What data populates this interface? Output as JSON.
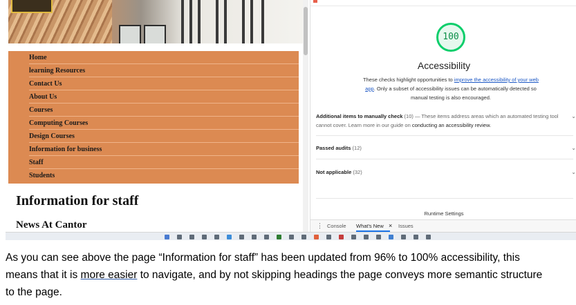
{
  "website": {
    "nav_items": [
      "Home",
      "learning Resources",
      "Contact Us",
      "About Us",
      "Courses",
      "Computing Courses",
      "Design Courses",
      "Information for business",
      "Staff",
      "Students"
    ],
    "page_title": "Information for staff",
    "section_heading": "News At Cantor"
  },
  "devtools": {
    "score": "100",
    "category_title": "Accessibility",
    "description_before": "These checks highlight opportunities to ",
    "description_link": "improve the accessibility of your web app",
    "description_after": ". Only a subset of accessibility issues can be automatically detected so manual testing is also encouraged.",
    "manual_label": "Additional items to manually check",
    "manual_count": "(10)",
    "manual_desc": " — These items address areas which an automated testing tool cannot cover. Learn more in our guide on ",
    "manual_link": "conducting an accessibility review",
    "manual_end": ".",
    "passed_label": "Passed audits",
    "passed_count": "(12)",
    "na_label": "Not applicable",
    "na_count": "(32)",
    "runtime_settings": "Runtime Settings",
    "drawer_tabs": [
      "Console",
      "What's New",
      "Issues"
    ],
    "score_color": "#0cce6b"
  },
  "caption": {
    "part1": "As you can see above the page “Information for staff” has been updated from 96% to 100% accessibility, this means that it is ",
    "underlined": "more easier",
    "part2": " to navigate, and by not skipping headings the page conveys more semantic structure to the page."
  }
}
